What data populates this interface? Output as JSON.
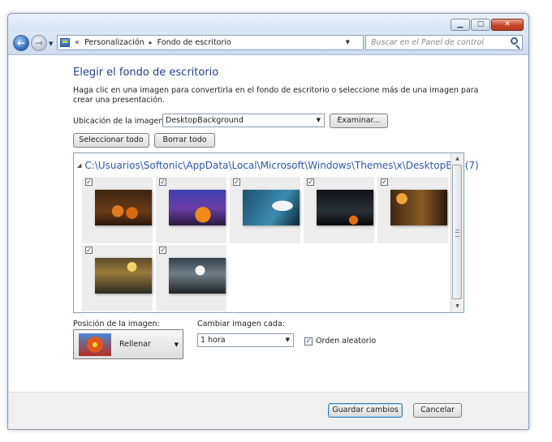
{
  "titlebar": {
    "minimize": "▁",
    "maximize": "▢",
    "close": "✕"
  },
  "nav": {
    "breadcrumb_prefix": "«",
    "breadcrumb": [
      "Personalización",
      "Fondo de escritorio"
    ],
    "breadcrumb_sep": "▸",
    "search_placeholder": "Buscar en el Panel de control"
  },
  "main": {
    "heading": "Elegir el fondo de escritorio",
    "description": "Haga clic en una imagen para convertirla en el fondo de escritorio o seleccione más de una imagen para crear una presentación.",
    "location_label": "Ubicación de la imagen:",
    "location_value": "DesktopBackground",
    "browse_label": "Examinar...",
    "select_all_label": "Seleccionar todo",
    "clear_all_label": "Borrar todo",
    "folder_path": "C:\\Usuarios\\Softonic\\AppData\\Local\\Microsoft\\Windows\\Themes\\x\\DesktopB...",
    "folder_count": "(7)",
    "images": [
      {
        "theme": "pumpkins-crate",
        "checked": true
      },
      {
        "theme": "jackolantern-purple-sky",
        "checked": true
      },
      {
        "theme": "ghost-blue",
        "checked": true
      },
      {
        "theme": "haunted-night",
        "checked": true
      },
      {
        "theme": "witch-window",
        "checked": true
      },
      {
        "theme": "scarecrow-field",
        "checked": true
      },
      {
        "theme": "moon-graveyard",
        "checked": true
      }
    ],
    "position_label": "Posición de la imagen:",
    "position_value": "Rellenar",
    "interval_label": "Cambiar imagen cada:",
    "interval_value": "1 hora",
    "shuffle_label": "Orden aleatorio",
    "shuffle_checked": true
  },
  "footer": {
    "save_label": "Guardar cambios",
    "cancel_label": "Cancelar"
  }
}
